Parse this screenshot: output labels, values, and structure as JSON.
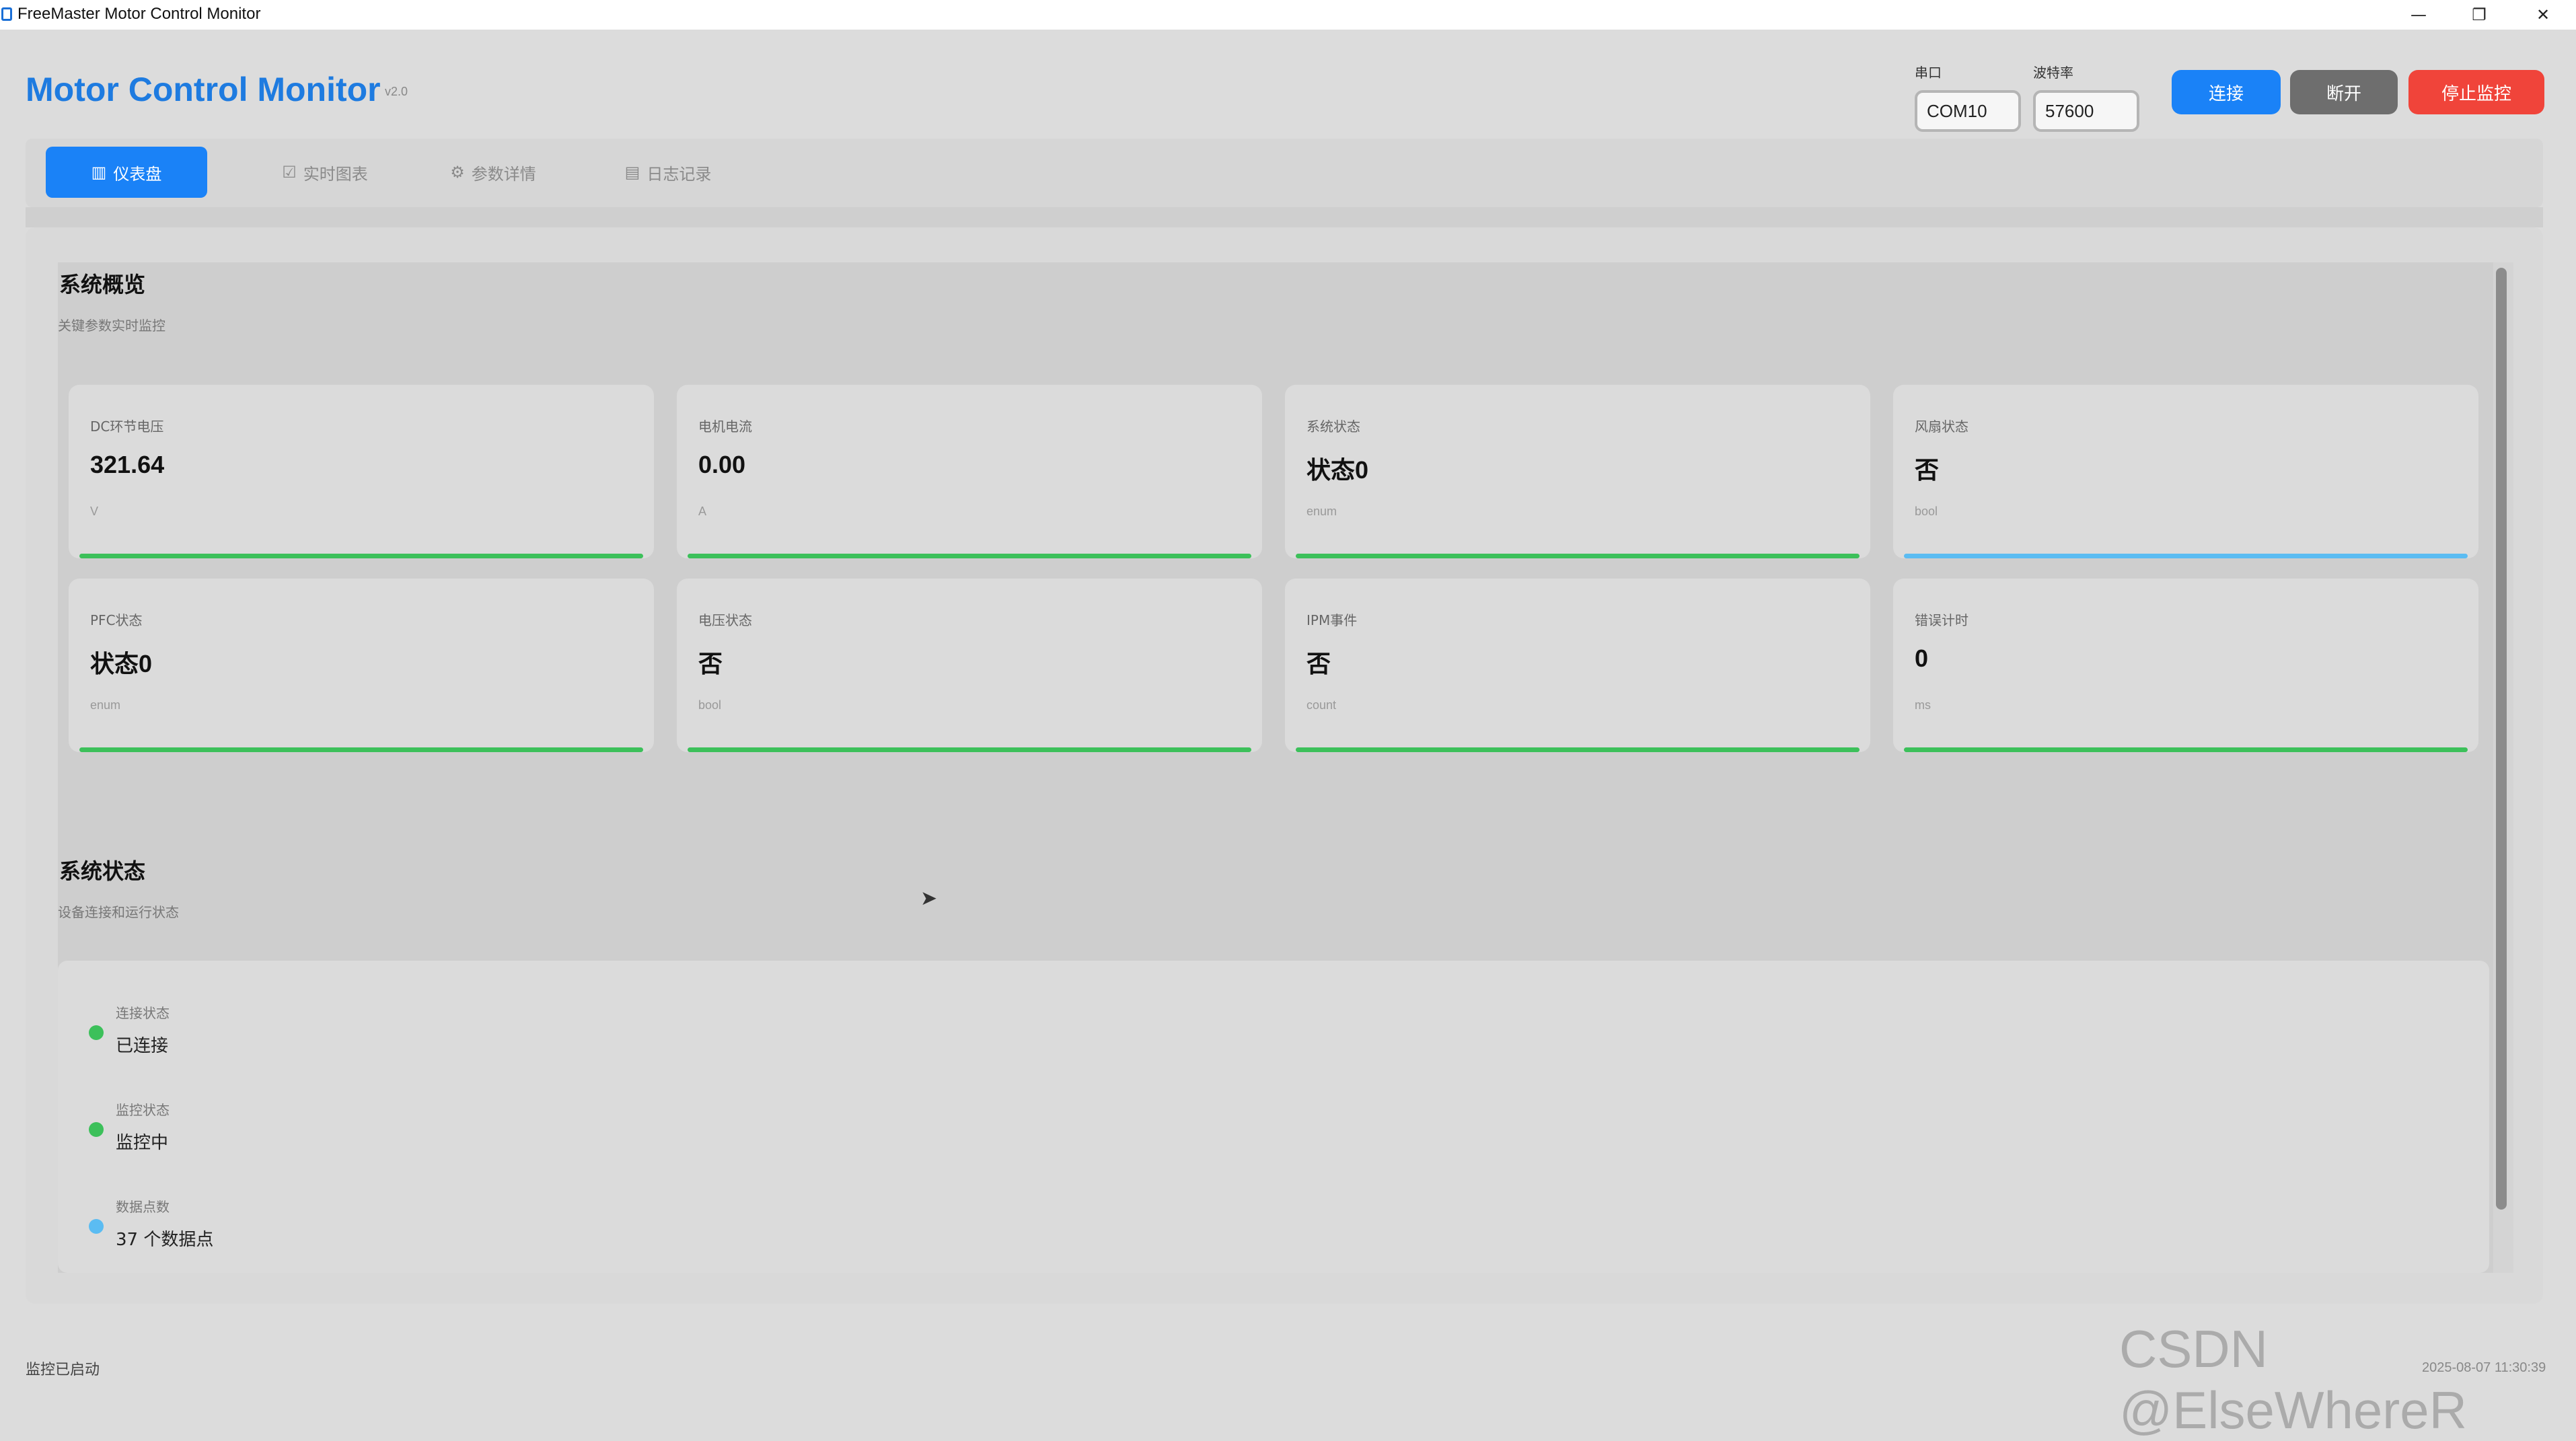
{
  "window": {
    "title": "FreeMaster Motor Control Monitor",
    "minimize_glyph": "—",
    "maximize_glyph": "❐",
    "close_glyph": "✕"
  },
  "header": {
    "title": "Motor Control Monitor",
    "version": "v2.0",
    "port_label": "串口",
    "port_value": "COM10",
    "baud_label": "波特率",
    "baud_value": "57600",
    "connect_label": "连接",
    "disconnect_label": "断开",
    "stop_label": "停止监控"
  },
  "tabs": [
    {
      "label": "仪表盘",
      "icon": "bar-chart-icon",
      "glyph": "▥",
      "active": true
    },
    {
      "label": "实时图表",
      "icon": "checkbox-chart-icon",
      "glyph": "☑",
      "active": false
    },
    {
      "label": "参数详情",
      "icon": "gear-icon",
      "glyph": "⚙",
      "active": false
    },
    {
      "label": "日志记录",
      "icon": "document-icon",
      "glyph": "▤",
      "active": false
    }
  ],
  "overview": {
    "title": "系统概览",
    "subtitle": "关键参数实时监控",
    "cards": [
      {
        "label": "DC环节电压",
        "value": "321.64",
        "unit": "V",
        "bar_color": "#3cc05a"
      },
      {
        "label": "电机电流",
        "value": "0.00",
        "unit": "A",
        "bar_color": "#3cc05a"
      },
      {
        "label": "系统状态",
        "value": "状态0",
        "unit": "enum",
        "bar_color": "#3cc05a"
      },
      {
        "label": "风扇状态",
        "value": "否",
        "unit": "bool",
        "bar_color": "#5bbcf2"
      },
      {
        "label": "PFC状态",
        "value": "状态0",
        "unit": "enum",
        "bar_color": "#3cc05a"
      },
      {
        "label": "电压状态",
        "value": "否",
        "unit": "bool",
        "bar_color": "#3cc05a"
      },
      {
        "label": "IPM事件",
        "value": "否",
        "unit": "count",
        "bar_color": "#3cc05a"
      },
      {
        "label": "错误计时",
        "value": "0",
        "unit": "ms",
        "bar_color": "#3cc05a"
      }
    ]
  },
  "system_status": {
    "title": "系统状态",
    "subtitle": "设备连接和运行状态",
    "items": [
      {
        "label": "连接状态",
        "value": "已连接",
        "dot_color": "#3cc05a"
      },
      {
        "label": "监控状态",
        "value": "监控中",
        "dot_color": "#3cc05a"
      },
      {
        "label": "数据点数",
        "value": "37 个数据点",
        "dot_color": "#5bbcf2"
      }
    ]
  },
  "footer": {
    "status": "监控已启动",
    "timestamp": "2025-08-07 11:30:39",
    "watermark": "CSDN @ElseWhereR"
  }
}
